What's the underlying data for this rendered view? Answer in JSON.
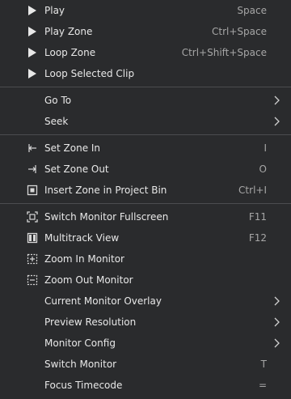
{
  "menu": {
    "group1": [
      {
        "label": "Play",
        "shortcut": "Space",
        "icon": "play-icon"
      },
      {
        "label": "Play Zone",
        "shortcut": "Ctrl+Space",
        "icon": "play-icon"
      },
      {
        "label": "Loop Zone",
        "shortcut": "Ctrl+Shift+Space",
        "icon": "play-icon"
      },
      {
        "label": "Loop Selected Clip",
        "shortcut": "",
        "icon": "play-icon"
      }
    ],
    "group2": [
      {
        "label": "Go To",
        "submenu": true
      },
      {
        "label": "Seek",
        "submenu": true
      }
    ],
    "group3": [
      {
        "label": "Set Zone In",
        "shortcut": "I",
        "icon": "zone-in-icon"
      },
      {
        "label": "Set Zone Out",
        "shortcut": "O",
        "icon": "zone-out-icon"
      },
      {
        "label": "Insert Zone in Project Bin",
        "shortcut": "Ctrl+I",
        "icon": "insert-zone-icon"
      }
    ],
    "group4": [
      {
        "label": "Switch Monitor Fullscreen",
        "shortcut": "F11",
        "icon": "fullscreen-icon"
      },
      {
        "label": "Multitrack View",
        "shortcut": "F12",
        "icon": "multitrack-icon"
      },
      {
        "label": "Zoom In Monitor",
        "shortcut": "",
        "icon": "zoom-in-icon"
      },
      {
        "label": "Zoom Out Monitor",
        "shortcut": "",
        "icon": "zoom-out-icon"
      },
      {
        "label": "Current Monitor Overlay",
        "submenu": true
      },
      {
        "label": "Preview Resolution",
        "submenu": true
      },
      {
        "label": "Monitor Config",
        "submenu": true
      },
      {
        "label": "Switch Monitor",
        "shortcut": "T"
      },
      {
        "label": "Focus Timecode",
        "shortcut": "="
      }
    ]
  },
  "colors": {
    "background": "#2a2b2d",
    "text": "#e8e8e8",
    "shortcut": "#a6a6a6",
    "separator": "#4b4c4f"
  }
}
